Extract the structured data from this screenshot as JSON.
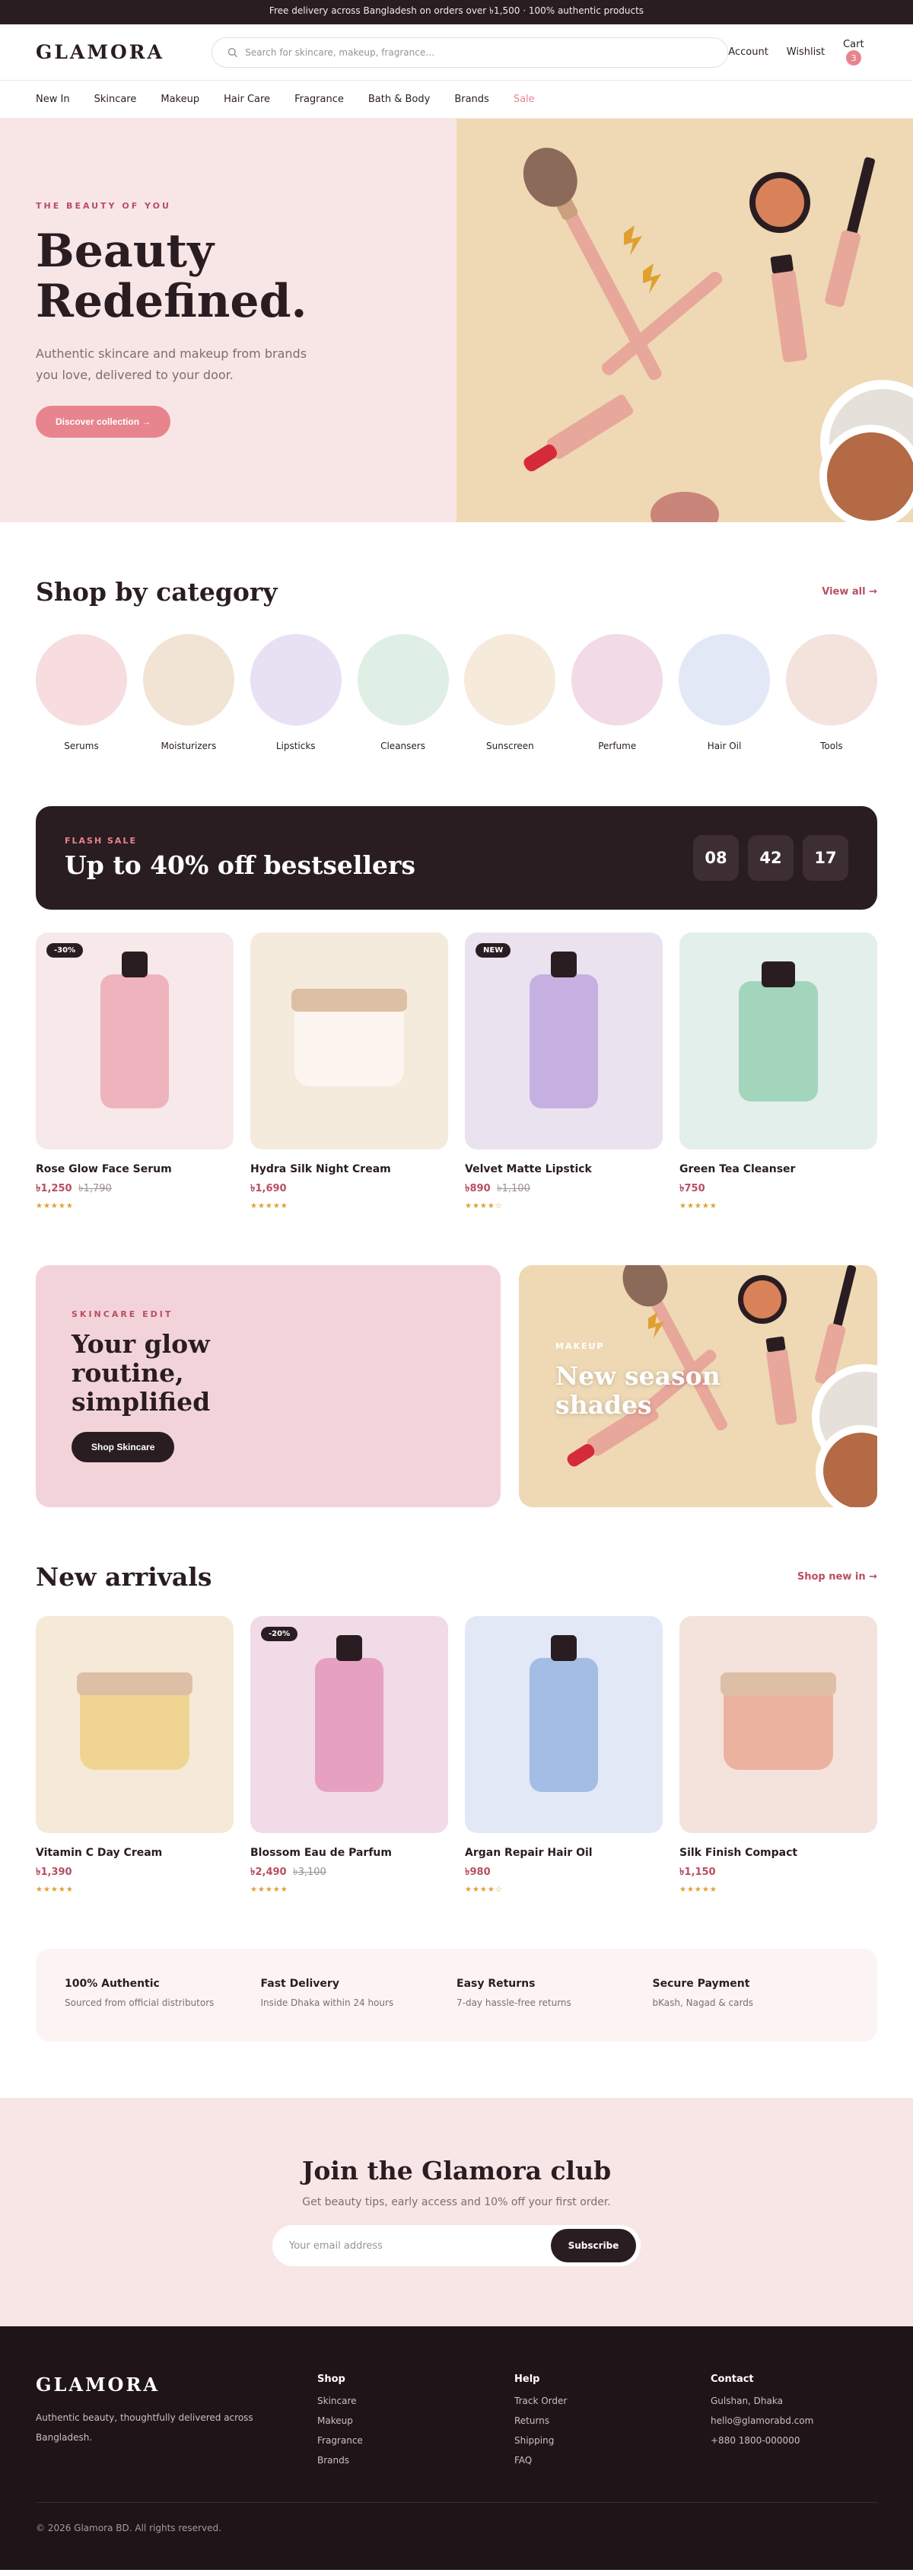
{
  "topbar": {
    "text": "Free delivery across Bangladesh on orders over ৳1,500 · 100% authentic products"
  },
  "header": {
    "logo": "GLAMORA",
    "search_placeholder": "Search for skincare, makeup, fragrance…",
    "account": "Account",
    "wishlist": "Wishlist",
    "cart": "Cart",
    "cart_count": "3"
  },
  "nav": [
    "New In",
    "Skincare",
    "Makeup",
    "Hair Care",
    "Fragrance",
    "Bath & Body",
    "Brands",
    "Sale"
  ],
  "hero": {
    "eyebrow": "THE BEAUTY OF YOU",
    "title_line1": "Beauty",
    "title_line2": "Redefined.",
    "subtitle": "Authentic skincare and makeup from brands you love, delivered to your door.",
    "cta": "Discover collection →"
  },
  "categories": {
    "title": "Shop by category",
    "link": "View all →",
    "items": [
      {
        "label": "Serums",
        "color": "#f7dde0"
      },
      {
        "label": "Moisturizers",
        "color": "#f2e4d4"
      },
      {
        "label": "Lipsticks",
        "color": "#e8e1f3"
      },
      {
        "label": "Cleansers",
        "color": "#dfefe6"
      },
      {
        "label": "Sunscreen",
        "color": "#f6eadb"
      },
      {
        "label": "Perfume",
        "color": "#f0dbe6"
      },
      {
        "label": "Hair Oil",
        "color": "#e2e8f6"
      },
      {
        "label": "Tools",
        "color": "#f4e2dc"
      }
    ]
  },
  "flash": {
    "eyebrow": "FLASH SALE",
    "title": "Up to 40% off bestsellers",
    "timer": [
      "08",
      "42",
      "17"
    ]
  },
  "bestsellers": [
    {
      "name": "Rose Glow Face Serum",
      "price": "৳1,250",
      "old": "৳1,790",
      "badge": "-30%",
      "bg": "#f7e9ea",
      "kind": "bottle",
      "color": "#efb3bd",
      "stars": "★★★★★"
    },
    {
      "name": "Hydra Silk Night Cream",
      "price": "৳1,690",
      "old": "",
      "badge": "",
      "bg": "#f4ebdd",
      "kind": "jar",
      "color": "#fcf5f0",
      "lid": "#ddbfa6",
      "stars": "★★★★★"
    },
    {
      "name": "Velvet Matte Lipstick",
      "price": "৳890",
      "old": "৳1,100",
      "badge": "NEW",
      "bg": "#ebe2ef",
      "kind": "bottle",
      "color": "#c6b0e1",
      "stars": "★★★★☆"
    },
    {
      "name": "Green Tea Cleanser",
      "price": "৳750",
      "old": "",
      "badge": "",
      "bg": "#e3efea",
      "kind": "bottle-wide",
      "color": "#a2d5bc",
      "stars": "★★★★★"
    }
  ],
  "promo": {
    "left": {
      "eyebrow": "SKINCARE EDIT",
      "line1": "Your glow",
      "line2": "routine,",
      "line3": "simplified",
      "cta": "Shop Skincare"
    },
    "right": {
      "eyebrow": "MAKEUP",
      "line1": "New season",
      "line2": "shades"
    }
  },
  "arrivals": {
    "title": "New arrivals",
    "link": "Shop new in →",
    "items": [
      {
        "name": "Vitamin C Day Cream",
        "price": "৳1,390",
        "old": "",
        "badge": "",
        "bg": "#f5ead8",
        "kind": "jar",
        "color": "#f0d592",
        "lid": "#ddbfa6",
        "stars": "★★★★★"
      },
      {
        "name": "Blossom Eau de Parfum",
        "price": "৳2,490",
        "old": "৳3,100",
        "badge": "-20%",
        "bg": "#f0dbe6",
        "kind": "bottle",
        "color": "#e6a1c0",
        "stars": "★★★★★"
      },
      {
        "name": "Argan Repair Hair Oil",
        "price": "৳980",
        "old": "",
        "badge": "",
        "bg": "#e2e8f6",
        "kind": "bottle",
        "color": "#a3bde4",
        "stars": "★★★★☆"
      },
      {
        "name": "Silk Finish Compact",
        "price": "৳1,150",
        "old": "",
        "badge": "",
        "bg": "#f4e2dc",
        "kind": "jar",
        "color": "#ebb39f",
        "lid": "#ddbfa6",
        "stars": "★★★★★"
      }
    ]
  },
  "features": [
    {
      "title": "100% Authentic",
      "desc": "Sourced from official distributors"
    },
    {
      "title": "Fast Delivery",
      "desc": "Inside Dhaka within 24 hours"
    },
    {
      "title": "Easy Returns",
      "desc": "7-day hassle-free returns"
    },
    {
      "title": "Secure Payment",
      "desc": "bKash, Nagad & cards"
    }
  ],
  "club": {
    "title": "Join the Glamora club",
    "subtitle": "Get beauty tips, early access and 10% off your first order.",
    "placeholder": "Your email address",
    "button": "Subscribe"
  },
  "footer": {
    "logo": "GLAMORA",
    "tagline": "Authentic beauty, thoughtfully delivered across Bangladesh.",
    "shop_title": "Shop",
    "shop": [
      "Skincare",
      "Makeup",
      "Fragrance",
      "Brands"
    ],
    "help_title": "Help",
    "help": [
      "Track Order",
      "Returns",
      "Shipping",
      "FAQ"
    ],
    "contact_title": "Contact",
    "contact": [
      "Gulshan, Dhaka",
      "hello@glamorabd.com",
      "+880 1800-000000"
    ],
    "copyright": "© 2026 Glamora BD. All rights reserved."
  }
}
